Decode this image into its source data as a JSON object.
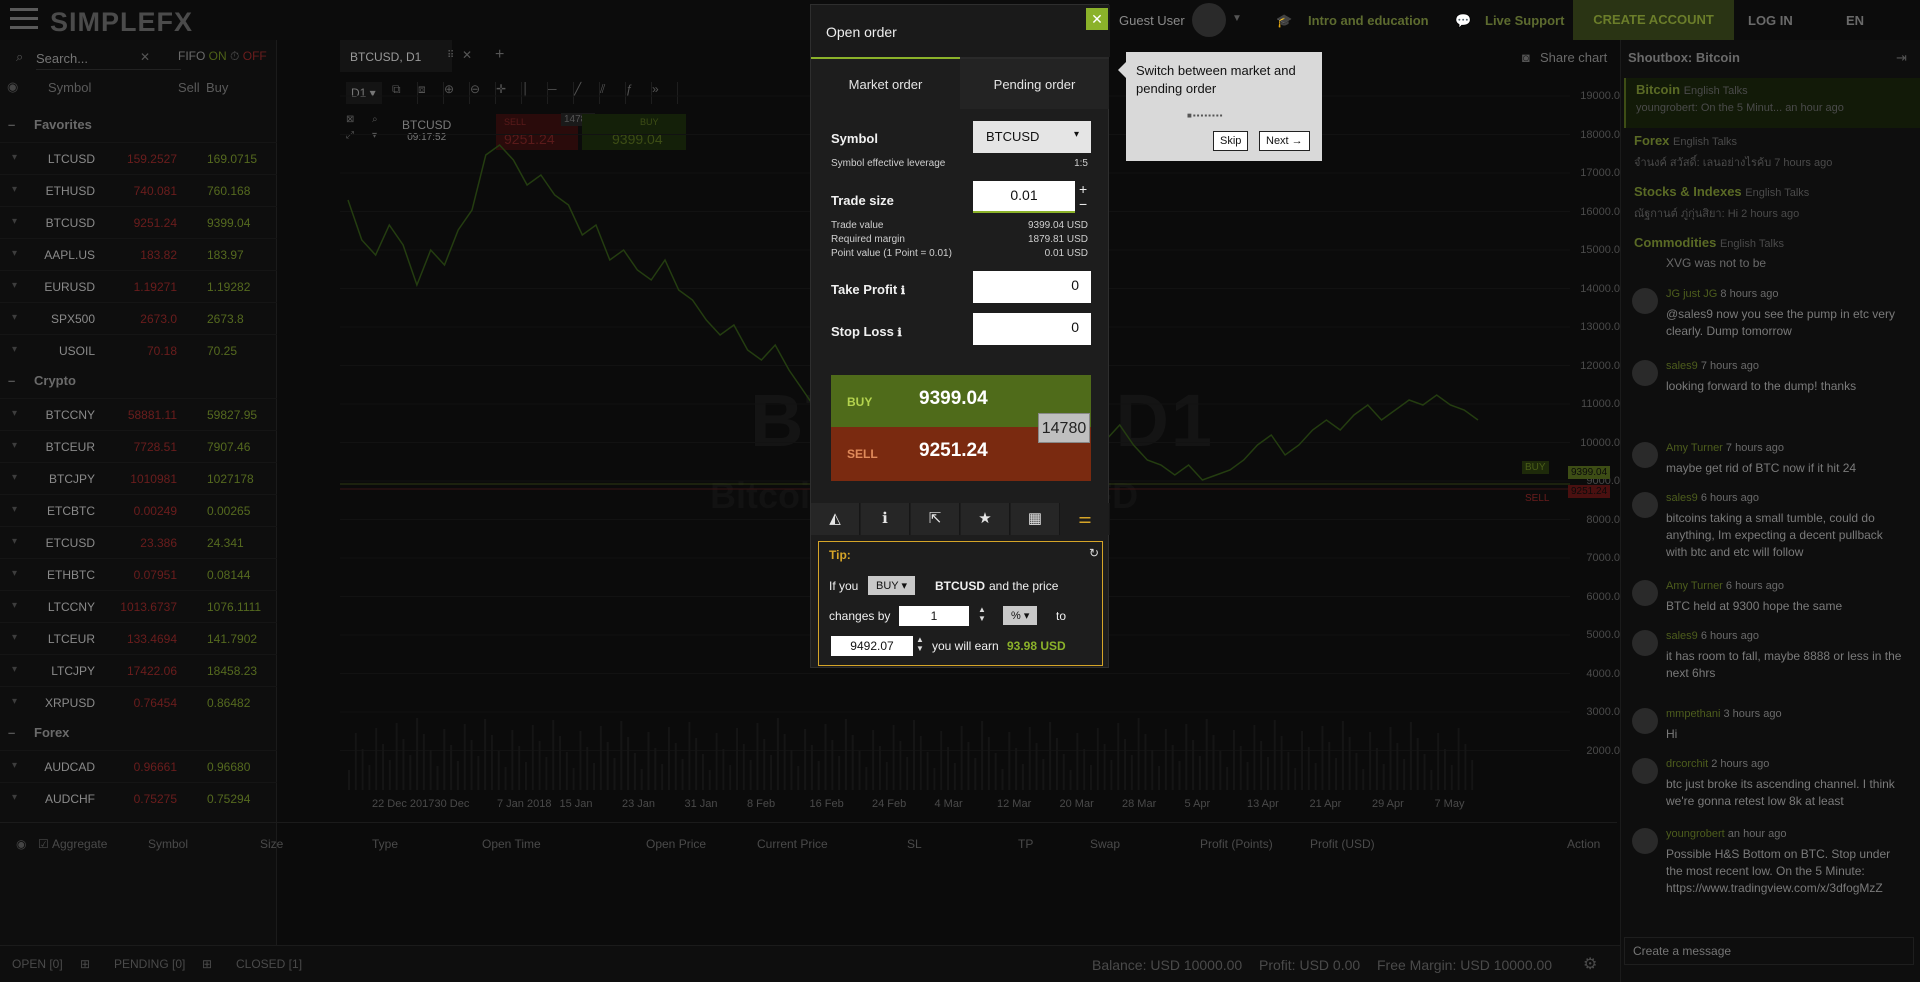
{
  "app": {
    "logo": "SIMPLEFX"
  },
  "topbar": {
    "guest": "Guest User",
    "intro": "Intro and education",
    "support": "Live Support",
    "create": "CREATE ACCOUNT",
    "login": "LOG IN",
    "lang": "EN"
  },
  "watchlist": {
    "search_placeholder": "Search...",
    "fifo": "FIFO",
    "fifo_on": "ON",
    "fifo_off": "OFF",
    "headers": {
      "symbol": "Symbol",
      "sell": "Sell",
      "buy": "Buy"
    },
    "groups": [
      {
        "name": "Favorites",
        "rows": [
          {
            "sym": "LTCUSD",
            "sell": "159.2527",
            "buy": "169.0715"
          },
          {
            "sym": "ETHUSD",
            "sell": "740.081",
            "buy": "760.168"
          },
          {
            "sym": "BTCUSD",
            "sell": "9251.24",
            "buy": "9399.04"
          },
          {
            "sym": "AAPL.US",
            "sell": "183.82",
            "buy": "183.97"
          },
          {
            "sym": "EURUSD",
            "sell": "1.19271",
            "buy": "1.19282"
          },
          {
            "sym": "SPX500",
            "sell": "2673.0",
            "buy": "2673.8"
          },
          {
            "sym": "USOIL",
            "sell": "70.18",
            "buy": "70.25"
          }
        ]
      },
      {
        "name": "Crypto",
        "rows": [
          {
            "sym": "BTCCNY",
            "sell": "58881.11",
            "buy": "59827.95"
          },
          {
            "sym": "BTCEUR",
            "sell": "7728.51",
            "buy": "7907.46"
          },
          {
            "sym": "BTCJPY",
            "sell": "1010981",
            "buy": "1027178"
          },
          {
            "sym": "ETCBTC",
            "sell": "0.00249",
            "buy": "0.00265"
          },
          {
            "sym": "ETCUSD",
            "sell": "23.386",
            "buy": "24.341"
          },
          {
            "sym": "ETHBTC",
            "sell": "0.07951",
            "buy": "0.08144"
          },
          {
            "sym": "LTCCNY",
            "sell": "1013.6737",
            "buy": "1076.1111"
          },
          {
            "sym": "LTCEUR",
            "sell": "133.4694",
            "buy": "141.7902"
          },
          {
            "sym": "LTCJPY",
            "sell": "17422.06",
            "buy": "18458.23"
          },
          {
            "sym": "XRPUSD",
            "sell": "0.76454",
            "buy": "0.86482"
          }
        ]
      },
      {
        "name": "Forex",
        "rows": [
          {
            "sym": "AUDCAD",
            "sell": "0.96661",
            "buy": "0.96680"
          },
          {
            "sym": "AUDCHF",
            "sell": "0.75275",
            "buy": "0.75294"
          }
        ]
      }
    ]
  },
  "chart": {
    "tab": "BTCUSD, D1",
    "share": "Share chart",
    "timeframe": "D1",
    "symbol": "BTCUSD",
    "time": "09:17:52",
    "sell_label": "SELL",
    "sell": "9251.24",
    "buy_label": "BUY",
    "buy": "9399.04",
    "spread": "14780",
    "watermark": "BTCUSD, D1",
    "watermark2": "Bitcoin vs US Dollar CFD",
    "yticks": [
      "19000.0",
      "18000.0",
      "17000.0",
      "16000.0",
      "15000.0",
      "14000.0",
      "13000.0",
      "12000.0",
      "11000.0",
      "10000.0",
      "9000.0",
      "8000.0",
      "7000.0",
      "6000.0",
      "5000.0",
      "4000.0",
      "3000.0",
      "2000.0"
    ],
    "xticks": [
      "22 Dec 2017",
      "30 Dec",
      "7 Jan 2018",
      "15 Jan",
      "23 Jan",
      "31 Jan",
      "8 Feb",
      "16 Feb",
      "24 Feb",
      "4 Mar",
      "12 Mar",
      "20 Mar",
      "28 Mar",
      "5 Apr",
      "13 Apr",
      "21 Apr",
      "29 Apr",
      "7 May"
    ],
    "tag_buy": "BUY",
    "tag_buy_val": "9399.04",
    "tag_sell": "SELL",
    "tag_sell_val": "9251.24"
  },
  "orders": {
    "headers": [
      "Aggregate",
      "Symbol",
      "Size",
      "Type",
      "Open Time",
      "Open Price",
      "Current Price",
      "SL",
      "TP",
      "Swap",
      "Profit (Points)",
      "Profit (USD)",
      "Action"
    ],
    "tabs": [
      "OPEN [0]",
      "PENDING [0]",
      "CLOSED [1]"
    ],
    "balance": "Balance: USD 10000.00",
    "profit": "Profit: USD 0.00",
    "free": "Free Margin: USD 10000.00"
  },
  "modal": {
    "title": "Open order",
    "close": "✕",
    "tab_market": "Market order",
    "tab_pending": "Pending order",
    "symbol_label": "Symbol",
    "symbol": "BTCUSD",
    "leverage_label": "Symbol effective leverage",
    "leverage": "1:5",
    "trade_size_label": "Trade size",
    "trade_size": "0.01",
    "trade_value_label": "Trade value",
    "trade_value": "9399.04 USD",
    "margin_label": "Required margin",
    "margin": "1879.81 USD",
    "point_label": "Point value (1 Point = 0.01)",
    "point": "0.01 USD",
    "tp_label": "Take Profit",
    "tp": "0",
    "sl_label": "Stop Loss",
    "sl": "0",
    "buy_label": "BUY",
    "buy": "9399.04",
    "sell_label": "SELL",
    "sell": "9251.24",
    "spread": "14780",
    "tip_title": "Tip:",
    "tip_if": "If you",
    "tip_action": "BUY",
    "tip_sym": "BTCUSD",
    "tip_price": "and the price",
    "tip_changes": "changes by",
    "tip_amount": "1",
    "tip_unit": "%",
    "tip_to": "to",
    "tip_target": "9492.07",
    "tip_earn": "you will earn",
    "tip_earn_val": "93.98 USD"
  },
  "tooltip": {
    "text": "Switch between market and pending order",
    "skip": "Skip",
    "next": "Next →"
  },
  "shoutbox": {
    "title": "Shoutbox: Bitcoin",
    "channels": [
      {
        "name": "Bitcoin",
        "lang": "English Talks",
        "last": "youngrobert: On the 5 Minut... an hour ago"
      },
      {
        "name": "Forex",
        "lang": "English Talks",
        "last": "จำนงค์ สวัสดิ์: เลนอย่างไรค้บ 7 hours ago"
      },
      {
        "name": "Stocks & Indexes",
        "lang": "English Talks",
        "last": "ณัฐกานต์ ภู่กุ่นสิยา: Hi 2 hours ago"
      },
      {
        "name": "Commodities",
        "lang": "English Talks",
        "last": ""
      }
    ],
    "pre": "XVG was not to be",
    "messages": [
      {
        "who": "JG just JG",
        "when": "8 hours ago",
        "text": "@sales9 now you see the pump in etc very clearly. Dump tomorrow"
      },
      {
        "who": "sales9",
        "when": "7 hours ago",
        "text": "looking forward to the dump! thanks"
      },
      {
        "who": "Amy Turner",
        "when": "7 hours ago",
        "text": "maybe get rid of BTC now if it hit 24"
      },
      {
        "who": "sales9",
        "when": "6 hours ago",
        "text": "bitcoins taking a small tumble, could do anything, Im expecting a decent pullback with btc and etc will follow"
      },
      {
        "who": "Amy Turner",
        "when": "6 hours ago",
        "text": "BTC held at 9300 hope the same"
      },
      {
        "who": "sales9",
        "when": "6 hours ago",
        "text": "it has room to fall, maybe 8888 or less in the next 6hrs"
      },
      {
        "who": "mmpethani",
        "when": "3 hours ago",
        "text": "Hi"
      },
      {
        "who": "drcorchit",
        "when": "2 hours ago",
        "text": "btc just broke its ascending channel. I think we're gonna retest low 8k at least"
      },
      {
        "who": "youngrobert",
        "when": "an hour ago",
        "text": "Possible H&S Bottom on BTC. Stop under the most recent low. On the 5 Minute: https://www.tradingview.com/x/3dfogMzZ"
      }
    ],
    "placeholder": "Create a message"
  },
  "series": [
    0.82,
    0.74,
    0.71,
    0.77,
    0.73,
    0.65,
    0.72,
    0.69,
    0.76,
    0.8,
    0.91,
    0.93,
    0.9,
    0.85,
    0.87,
    0.83,
    0.81,
    0.75,
    0.77,
    0.7,
    0.72,
    0.68,
    0.66,
    0.7,
    0.64,
    0.62,
    0.58,
    0.55,
    0.57,
    0.52,
    0.5,
    0.53,
    0.48,
    0.44,
    0.4,
    0.37,
    0.33,
    0.25,
    0.3,
    0.28,
    0.36,
    0.38,
    0.35,
    0.4,
    0.42,
    0.45,
    0.43,
    0.41,
    0.44,
    0.46,
    0.43,
    0.41,
    0.38,
    0.39,
    0.36,
    0.34,
    0.37,
    0.33,
    0.3,
    0.29,
    0.27,
    0.29,
    0.26,
    0.27,
    0.28,
    0.3,
    0.33,
    0.35,
    0.31,
    0.33,
    0.36,
    0.38,
    0.36,
    0.39,
    0.41,
    0.38,
    0.4,
    0.42,
    0.41,
    0.43,
    0.41,
    0.4,
    0.38
  ]
}
